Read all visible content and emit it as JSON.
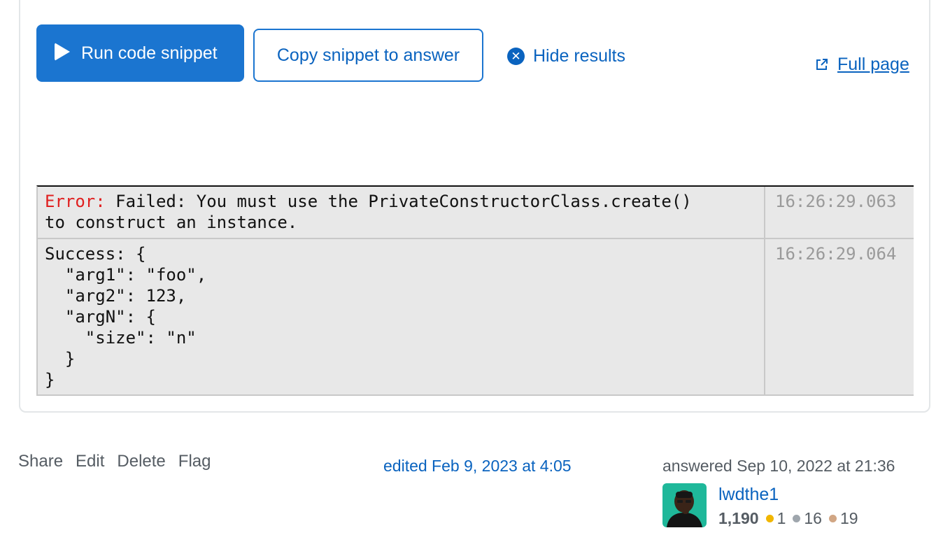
{
  "toolbar": {
    "run_label": "Run code snippet",
    "copy_label": "Copy snippet to answer",
    "hide_label": "Hide results",
    "full_page_label": "Full page"
  },
  "console": {
    "rows": [
      {
        "label": "Error:",
        "message": " Failed: You must use the PrivateConstructorClass.create()\nto construct an instance.",
        "time": "16:26:29.063"
      },
      {
        "message": "Success: {\n  \"arg1\": \"foo\",\n  \"arg2\": 123,\n  \"argN\": {\n    \"size\": \"n\"\n  }\n}",
        "time": "16:26:29.064"
      }
    ]
  },
  "post_menu": {
    "share": "Share",
    "edit": "Edit",
    "delete": "Delete",
    "flag": "Flag"
  },
  "edited": "edited Feb 9, 2023 at 4:05",
  "answered": "answered Sep 10, 2022 at 21:36",
  "user": {
    "name": "lwdthe1",
    "reputation": "1,190",
    "gold": "1",
    "silver": "16",
    "bronze": "19"
  },
  "colors": {
    "accent": "#1b75d0",
    "link": "#0a63bf",
    "error": "#e02020",
    "gold": "#f1b600",
    "silver": "#9fa6ad",
    "bronze": "#d1a684"
  }
}
